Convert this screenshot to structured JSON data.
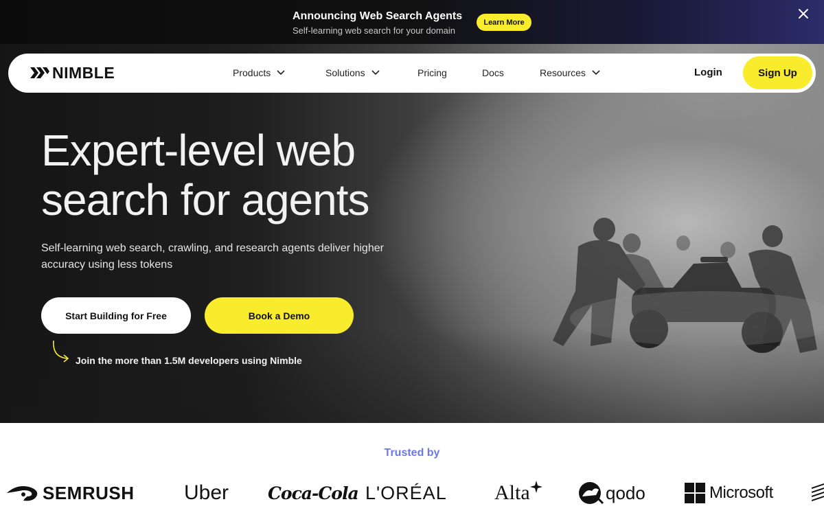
{
  "announcement": {
    "title": "Announcing Web Search Agents",
    "subtitle": "Self-learning web search for your domain",
    "cta": "Learn More",
    "close_icon": "close-icon"
  },
  "nav": {
    "brand": "NIMBLE",
    "items": [
      {
        "label": "Products",
        "has_dropdown": true
      },
      {
        "label": "Solutions",
        "has_dropdown": true
      },
      {
        "label": "Pricing",
        "has_dropdown": false
      },
      {
        "label": "Docs",
        "has_dropdown": false
      },
      {
        "label": "Resources",
        "has_dropdown": true
      }
    ],
    "login": "Login",
    "signup": "Sign Up"
  },
  "hero": {
    "headline_line1": "Expert-level web",
    "headline_line2": "search for agents",
    "subhead": "Self-learning web search, crawling, and research agents deliver higher accuracy using less tokens",
    "primary_cta": "Start Building for Free",
    "secondary_cta": "Book a Demo",
    "developer_note": "Join the more than 1.5M developers using Nimble"
  },
  "trusted": {
    "label": "Trusted by",
    "logos": [
      "SEMRUSH",
      "Uber",
      "Coca-Cola",
      "L'ORÉAL",
      "Alta",
      "qodo",
      "Microsoft"
    ]
  },
  "colors": {
    "accent_yellow": "#f8ec2c",
    "trusted_label": "#6b78e5",
    "dark": "#111111"
  }
}
